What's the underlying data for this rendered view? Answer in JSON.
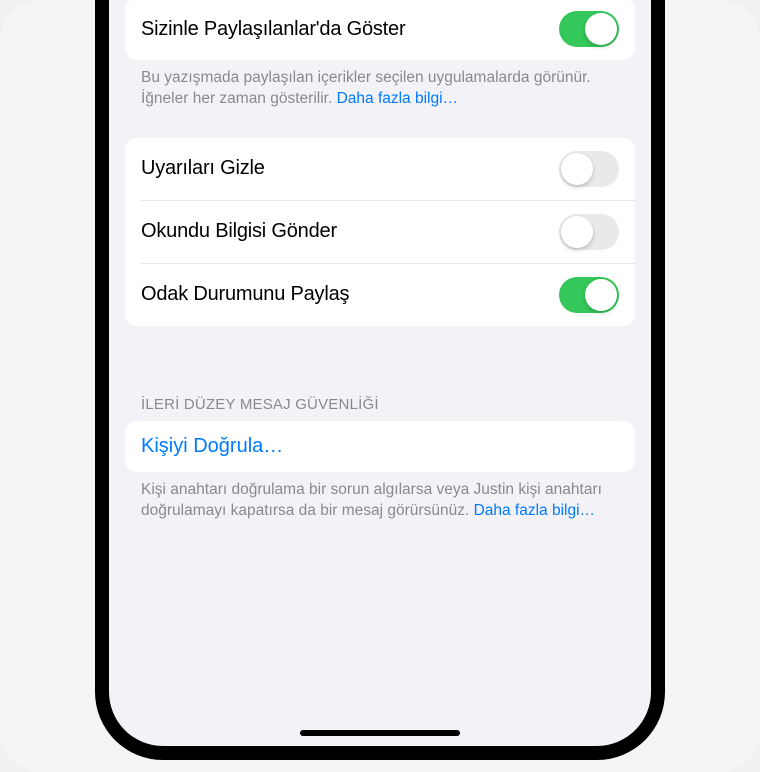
{
  "section1": {
    "show_in_shared": "Sizinle Paylaşılanlar'da Göster",
    "footer": "Bu yazışmada paylaşılan içerikler seçilen uygulamalarda görünür. İğneler her zaman gösterilir.",
    "footer_link": "Daha fazla bilgi…"
  },
  "section2": {
    "hide_alerts": "Uyarıları Gizle",
    "send_read": "Okundu Bilgisi Gönder",
    "share_focus": "Odak Durumunu Paylaş"
  },
  "section3": {
    "header": "İLERİ DÜZEY MESAJ GÜVENLİĞİ",
    "verify": "Kişiyi Doğrula…",
    "footer": "Kişi anahtarı doğrulama bir sorun algılarsa veya Justin kişi anahtarı doğrulamayı kapatırsa da bir mesaj görürsünüz. ",
    "footer_link": "Daha fazla bilgi…"
  }
}
